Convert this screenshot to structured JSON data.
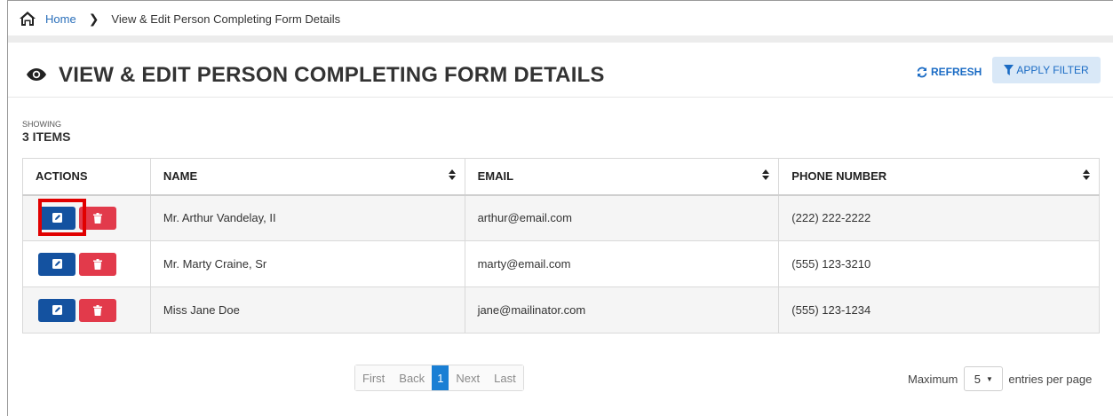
{
  "breadcrumb": {
    "home": "Home",
    "current": "View & Edit Person Completing Form Details"
  },
  "header": {
    "title": "VIEW & EDIT PERSON COMPLETING FORM DETAILS",
    "refresh_label": "REFRESH",
    "filter_label": "APPLY FILTER"
  },
  "summary": {
    "showing_label": "SHOWING",
    "count_label": "3 ITEMS"
  },
  "table": {
    "columns": [
      "ACTIONS",
      "NAME",
      "EMAIL",
      "PHONE NUMBER"
    ],
    "rows": [
      {
        "name": "Mr. Arthur Vandelay, II",
        "email": "arthur@email.com",
        "phone": "(222) 222-2222"
      },
      {
        "name": "Mr. Marty Craine, Sr",
        "email": "marty@email.com",
        "phone": "(555) 123-3210"
      },
      {
        "name": "Miss Jane Doe",
        "email": "jane@mailinator.com",
        "phone": "(555) 123-1234"
      }
    ]
  },
  "pagination": {
    "first": "First",
    "back": "Back",
    "current_page": "1",
    "next": "Next",
    "last": "Last"
  },
  "per_page": {
    "prefix": "Maximum",
    "value": "5",
    "suffix": "entries per page"
  },
  "colors": {
    "link": "#2a6fba",
    "edit_button": "#1452a0",
    "delete_button": "#e23a4b",
    "active_page": "#1a7fd4",
    "highlight": "#e10000"
  },
  "icons": [
    "home-icon",
    "chevron-right-icon",
    "eye-icon",
    "refresh-icon",
    "filter-icon",
    "sort-icon",
    "edit-icon",
    "trash-icon",
    "caret-down-icon"
  ]
}
